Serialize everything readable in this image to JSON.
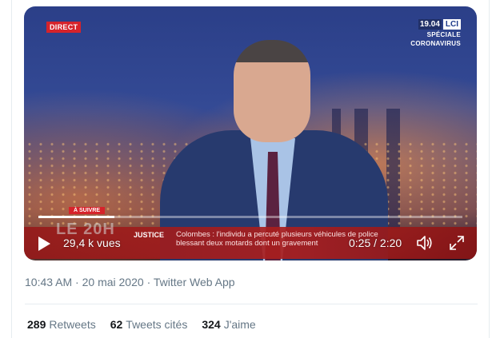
{
  "video": {
    "live_badge": "DIRECT",
    "channel_time": "19.04",
    "channel_brand": "LCI",
    "special_line1": "SPÉCIALE",
    "special_line2": "CORONAVIRUS",
    "up_next": "À SUIVRE",
    "brand_watermark": "LE 20H",
    "section": "JUSTICE",
    "ticker_line1": "Colombes : l'individu a percuté plusieurs véhicules de police",
    "ticker_line2": "blessant deux motards dont un gravement",
    "views": "29,4 k vues",
    "timecode": "0:25 / 2:20",
    "progress_fraction": 0.18
  },
  "tweet": {
    "time": "10:43 AM",
    "separator": "·",
    "date": "20 mai 2020",
    "source": "Twitter Web App"
  },
  "stats": {
    "retweets_count": "289",
    "retweets_label": "Retweets",
    "quotes_count": "62",
    "quotes_label": "Tweets cités",
    "likes_count": "324",
    "likes_label": "J'aime"
  }
}
